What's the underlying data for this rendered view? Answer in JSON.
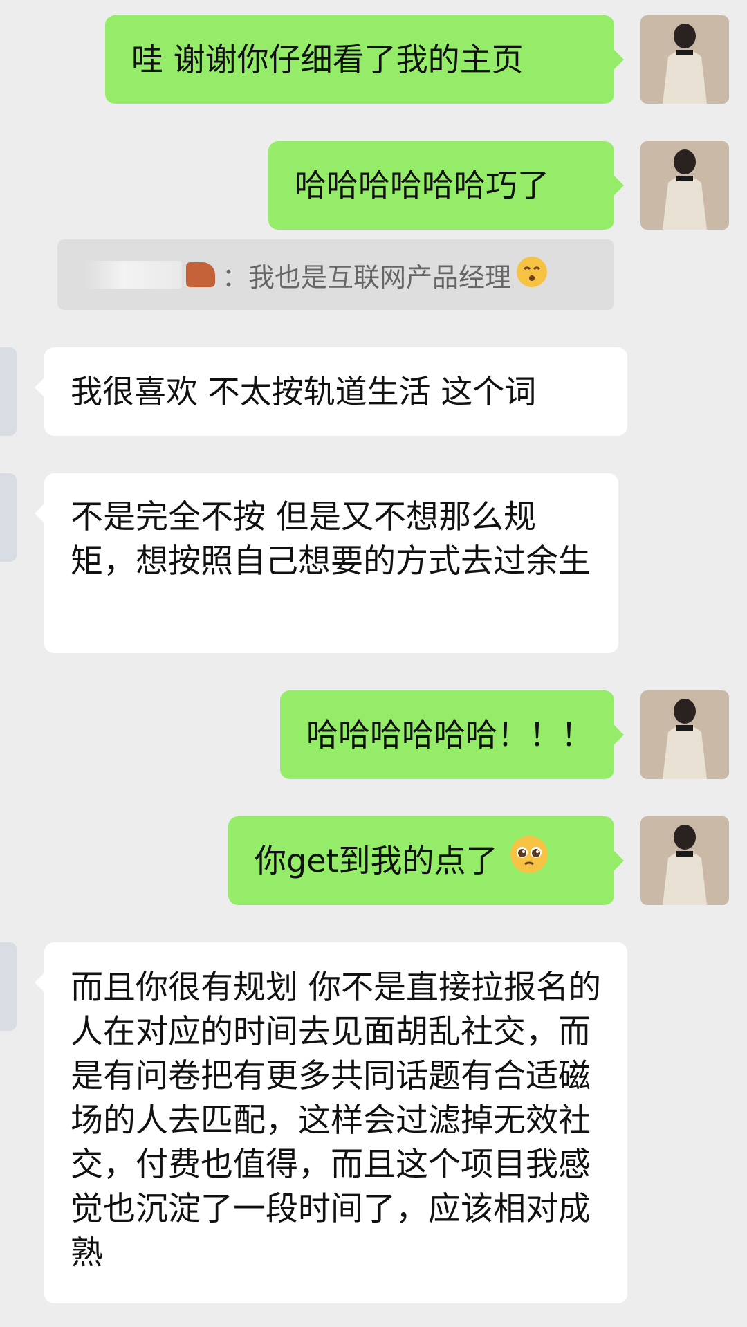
{
  "messages": {
    "m1": "哇  谢谢你仔细看了我的主页",
    "m2": "哈哈哈哈哈哈巧了",
    "quote": {
      "sep": "：",
      "text": "我也是互联网产品经理"
    },
    "m3": "我很喜欢 不太按轨道生活 这个词",
    "m4": "不是完全不按 但是又不想那么规矩，想按照自己想要的方式去过余生",
    "m5": "哈哈哈哈哈哈！！！",
    "m6": "你get到我的点了",
    "m7": "而且你很有规划  你不是直接拉报名的人在对应的时间去见面胡乱社交，而是有问卷把有更多共同话题有合适磁场的人去匹配，这样会过滤掉无效社交，付费也值得，而且这个项目我感觉也沉淀了一段时间了，应该相对成熟"
  },
  "icons": {
    "self_avatar": "avatar-photo-icon",
    "other_avatar": "avatar-photo-icon",
    "emoji_quote": "kiss-face-emoji",
    "emoji_m6": "pleading-face-emoji"
  },
  "colors": {
    "background": "#ededed",
    "outgoing_bubble": "#95ec69",
    "incoming_bubble": "#ffffff"
  }
}
